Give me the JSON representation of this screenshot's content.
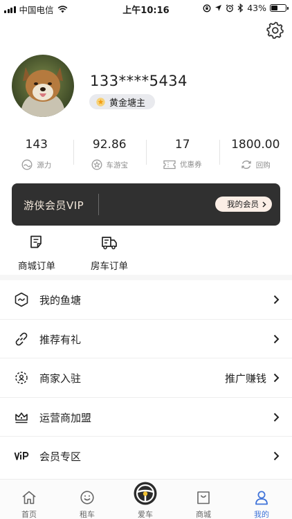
{
  "status_bar": {
    "carrier": "中国电信",
    "time": "上午10:16",
    "battery": "43%",
    "battery_level": 0.43
  },
  "profile": {
    "phone": "133****5434",
    "level_badge": "黄金塘主"
  },
  "stats": [
    {
      "value": "143",
      "label": "源力",
      "icon": "yuanli-icon"
    },
    {
      "value": "92.86",
      "label": "车游宝",
      "icon": "star-circle-icon"
    },
    {
      "value": "17",
      "label": "优惠券",
      "icon": "coupon-icon"
    },
    {
      "value": "1800.00",
      "label": "回购",
      "icon": "refresh-icon"
    }
  ],
  "vip": {
    "title": "游侠会员VIP",
    "button": "我的会员"
  },
  "orders": [
    {
      "label": "商城订单",
      "icon": "order-list-icon"
    },
    {
      "label": "房车订单",
      "icon": "rv-truck-icon"
    }
  ],
  "menu": [
    {
      "label": "我的鱼塘",
      "extra": "",
      "icon": "pond-icon"
    },
    {
      "label": "推荐有礼",
      "extra": "",
      "icon": "link-icon"
    },
    {
      "label": "商家入驻",
      "extra": "推广赚钱",
      "icon": "merchant-icon"
    },
    {
      "label": "运营商加盟",
      "extra": "",
      "icon": "crown-icon"
    },
    {
      "label": "会员专区",
      "extra": "",
      "icon": "vip-text-icon"
    }
  ],
  "tabs": [
    {
      "label": "首页",
      "icon": "home-icon",
      "active": false
    },
    {
      "label": "租车",
      "icon": "smile-icon",
      "active": false
    },
    {
      "label": "爱车",
      "icon": "steering-wheel-icon",
      "active": false
    },
    {
      "label": "商城",
      "icon": "bag-icon",
      "active": false
    },
    {
      "label": "我的",
      "icon": "person-icon",
      "active": true
    }
  ],
  "colors": {
    "accent": "#3f73d9",
    "vip_bg": "#303030",
    "vip_text": "#f3e7da",
    "vip_button_bg": "#fbeee6"
  }
}
